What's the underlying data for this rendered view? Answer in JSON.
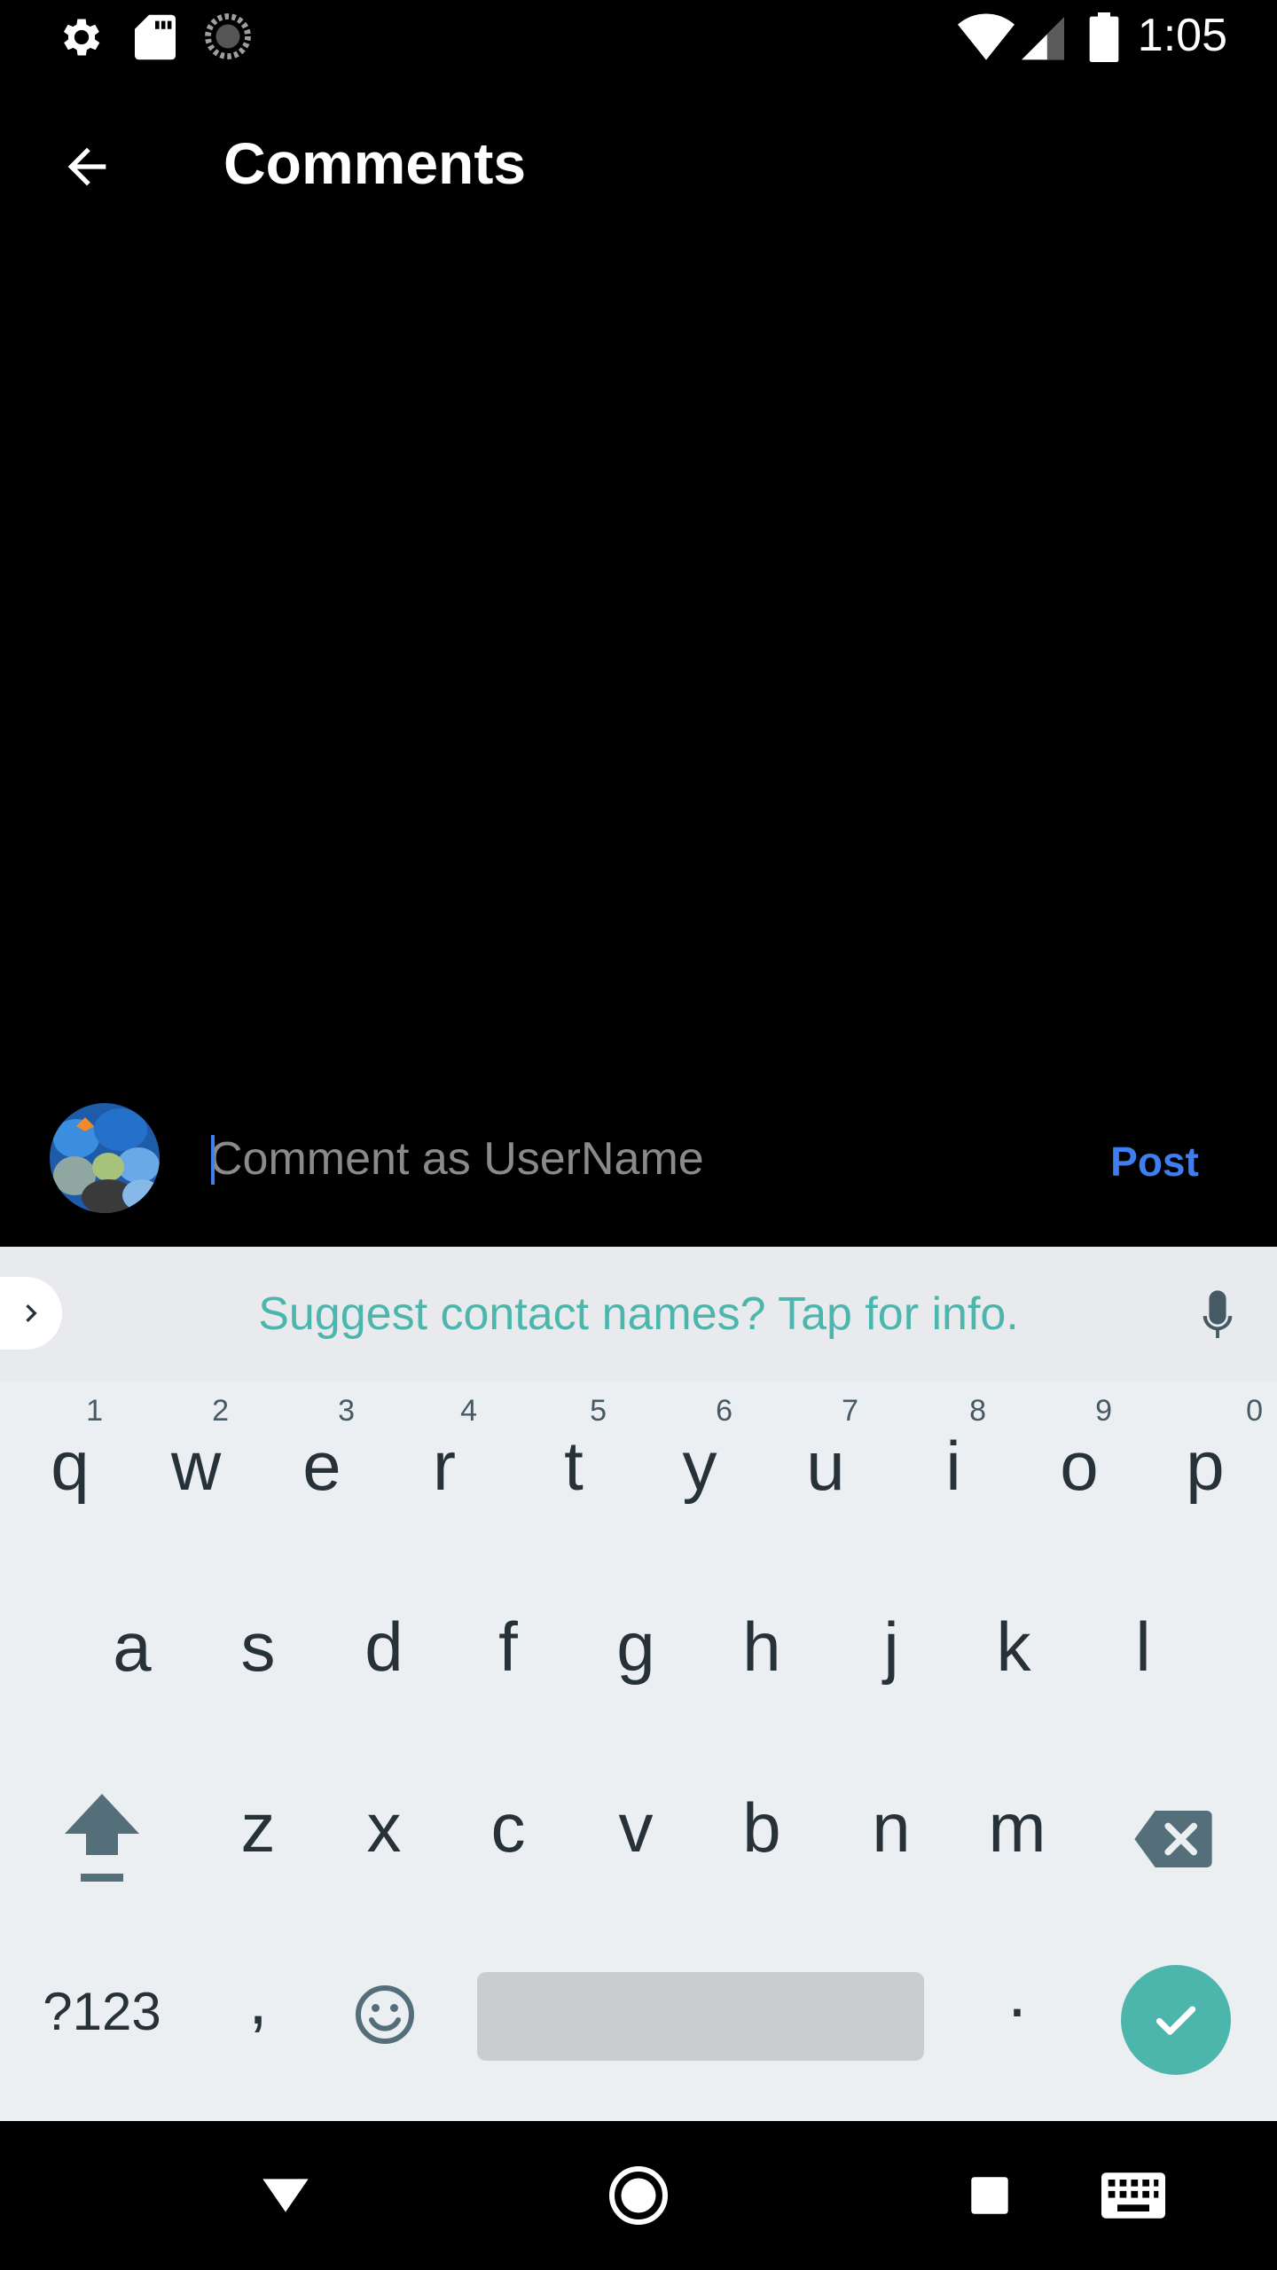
{
  "status_bar": {
    "time": "1:05",
    "icons": [
      "gear-icon",
      "sd-card-icon",
      "sync-icon",
      "wifi-icon",
      "signal-icon",
      "battery-icon"
    ]
  },
  "app_bar": {
    "title": "Comments",
    "back_icon": "arrow-back-icon"
  },
  "comment": {
    "placeholder": "Comment as UserName",
    "value": "",
    "post_label": "Post"
  },
  "keyboard": {
    "suggestion": "Suggest contact names? Tap for info.",
    "row1": [
      {
        "char": "q",
        "hint": "1"
      },
      {
        "char": "w",
        "hint": "2"
      },
      {
        "char": "e",
        "hint": "3"
      },
      {
        "char": "r",
        "hint": "4"
      },
      {
        "char": "t",
        "hint": "5"
      },
      {
        "char": "y",
        "hint": "6"
      },
      {
        "char": "u",
        "hint": "7"
      },
      {
        "char": "i",
        "hint": "8"
      },
      {
        "char": "o",
        "hint": "9"
      },
      {
        "char": "p",
        "hint": "0"
      }
    ],
    "row2": [
      "a",
      "s",
      "d",
      "f",
      "g",
      "h",
      "j",
      "k",
      "l"
    ],
    "row3": [
      "z",
      "x",
      "c",
      "v",
      "b",
      "n",
      "m"
    ],
    "symbols_label": "?123",
    "comma_label": ",",
    "period_label": "."
  },
  "colors": {
    "accent": "#3d7ef0",
    "keyboard_accent": "#4db6ac",
    "key_text": "#263238",
    "keyboard_bg": "#eceff1"
  }
}
